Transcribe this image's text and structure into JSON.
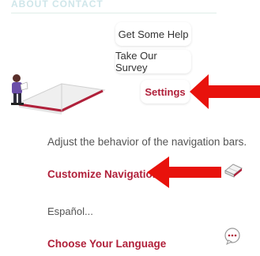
{
  "header": {
    "faded_label": "ABOUT CONTACT"
  },
  "menu": {
    "get_help": "Get Some Help",
    "take_survey": "Take Our Survey",
    "settings": "Settings"
  },
  "settings_panel": {
    "navigation_description": "Adjust the behavior of the navigation bars.",
    "customize_navigation": "Customize Navigation",
    "language_current": "Español...",
    "choose_language": "Choose Your Language"
  },
  "colors": {
    "accent": "#b0203a",
    "arrow": "#e8120c"
  }
}
